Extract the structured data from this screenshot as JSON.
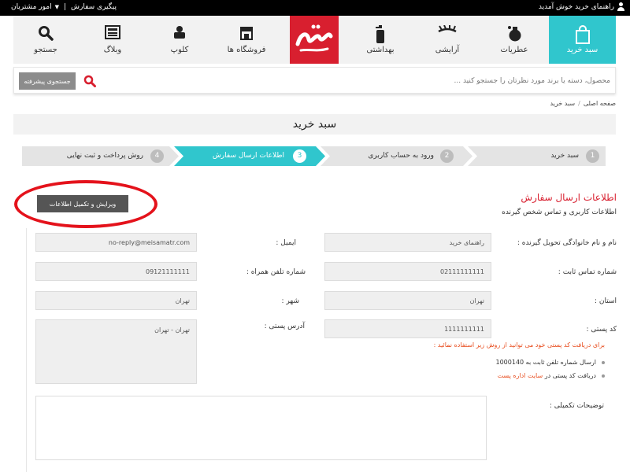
{
  "topbar": {
    "welcome": "راهنمای خرید خوش آمدید",
    "track_order": "پیگیری سفارش",
    "sep": "|",
    "customers": "امور مشتریان"
  },
  "nav": {
    "items": [
      {
        "label": "سبد خرید",
        "icon": "shopping-bag-icon",
        "active": true
      },
      {
        "label": "عطریات",
        "icon": "perfume-icon"
      },
      {
        "label": "آرایشی",
        "icon": "eyelash-icon"
      },
      {
        "label": "بهداشتی",
        "icon": "soap-bottle-icon"
      },
      {
        "label": "فروشگاه ها",
        "icon": "store-icon"
      },
      {
        "label": "کلوپ",
        "icon": "club-icon"
      },
      {
        "label": "وبلاگ",
        "icon": "blog-icon"
      },
      {
        "label": "جستجو",
        "icon": "search-icon"
      }
    ],
    "logo": "میثم عطر"
  },
  "search": {
    "placeholder": "محصول، دسته یا برند مورد نظرتان را جستجو کنید ...",
    "advanced": "جستجوی پیشرفته"
  },
  "breadcrumb": {
    "home": "صفحه اصلی",
    "sep": "/",
    "current": "سبد خرید"
  },
  "page_title": "سبد خرید",
  "steps": [
    {
      "num": "1",
      "label": "سبد خرید"
    },
    {
      "num": "2",
      "label": "ورود به حساب کاربری"
    },
    {
      "num": "3",
      "label": "اطلاعات ارسال سفارش",
      "active": true
    },
    {
      "num": "4",
      "label": "روش پرداخت و ثبت نهایی"
    }
  ],
  "info": {
    "title": "اطلاعات ارسال سفارش",
    "subtitle": "اطلاعات کاربری و تماس شخص گیرنده",
    "edit_button": "ویرایش و تکمیل اطلاعات"
  },
  "fields": {
    "name_label": "نام و نام خانوادگی تحویل گیرنده :",
    "name_value": "راهنمای خرید",
    "email_label": "ایمیل :",
    "email_value": "no-reply@meisamatr.com",
    "phone_label": "شماره تماس ثابت :",
    "phone_value": "02111111111",
    "mobile_label": "شماره تلفن همراه :",
    "mobile_value": "09121111111",
    "province_label": "استان :",
    "province_value": "تهران",
    "city_label": "شهر :",
    "city_value": "تهران",
    "postal_label": "کد پستی :",
    "postal_value": "1111111111",
    "address_label": "آدرس پستی :",
    "address_value": "تهران - تهران",
    "desc_label": "توضیحات تکمیلی :"
  },
  "postal_help": {
    "note": "برای دریافت کد پستی خود می توانید از روش زیر استفاده نمائید :",
    "sms_text": "ارسال شماره تلفن ثابت به 1000140",
    "site_text": "دریافت کد پستی در",
    "site_link": "سایت اداره پست"
  },
  "colors": {
    "accent": "#30c6cd",
    "brand": "#d81f2f",
    "highlight": "#e4121b",
    "note": "#e84b1c"
  }
}
